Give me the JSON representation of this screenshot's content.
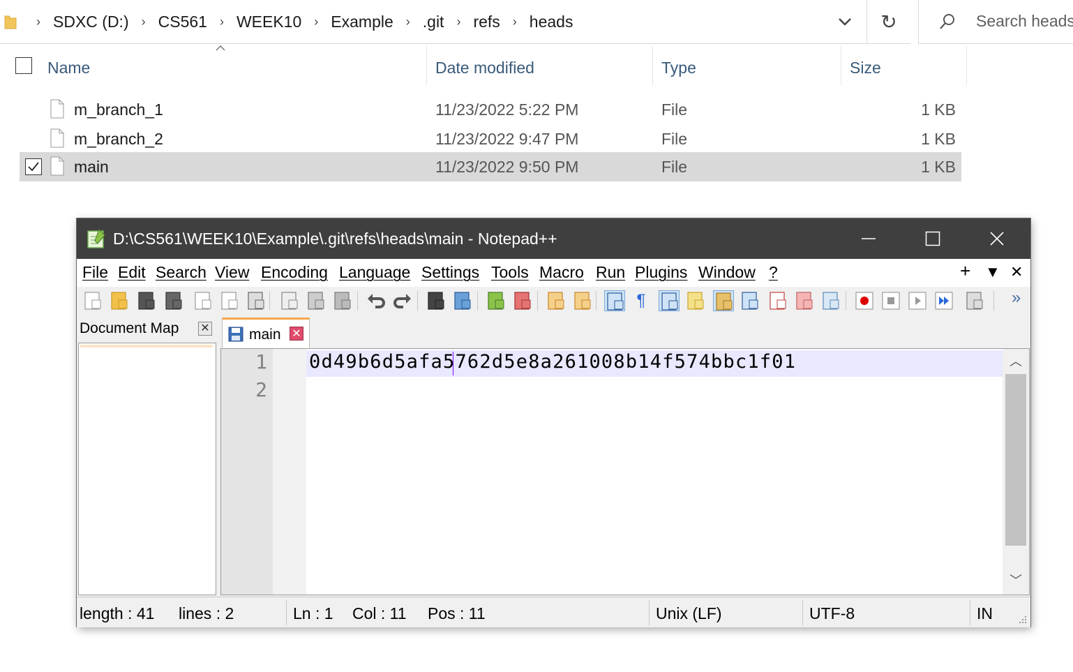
{
  "explorer": {
    "breadcrumb": [
      "SDXC (D:)",
      "CS561",
      "WEEK10",
      "Example",
      ".git",
      "refs",
      "heads"
    ],
    "search_placeholder": "Search heads",
    "columns": {
      "name": "Name",
      "date": "Date modified",
      "type": "Type",
      "size": "Size"
    },
    "files": [
      {
        "name": "m_branch_1",
        "date": "11/23/2022 5:22 PM",
        "type": "File",
        "size": "1 KB",
        "selected": false
      },
      {
        "name": "m_branch_2",
        "date": "11/23/2022 9:47 PM",
        "type": "File",
        "size": "1 KB",
        "selected": false
      },
      {
        "name": "main",
        "date": "11/23/2022 9:50 PM",
        "type": "File",
        "size": "1 KB",
        "selected": true
      }
    ]
  },
  "notepad": {
    "title": "D:\\CS561\\WEEK10\\Example\\.git\\refs\\heads\\main - Notepad++",
    "menu": [
      "File",
      "Edit",
      "Search",
      "View",
      "Encoding",
      "Language",
      "Settings",
      "Tools",
      "Macro",
      "Run",
      "Plugins",
      "Window",
      "?"
    ],
    "menu_right": {
      "plus": "+",
      "down": "▼",
      "close": "✕"
    },
    "toolbar_overflow": "»",
    "docmap_title": "Document Map",
    "tab_label": "main",
    "line_numbers": [
      "1",
      "2"
    ],
    "content_line1": "0d49b6d5afa5762d5e8a261008b14f574bbc1f01",
    "status": {
      "length": "length : 41",
      "lines": "lines : 2",
      "ln": "Ln : 1",
      "col": "Col : 11",
      "pos": "Pos : 11",
      "eol": "Unix (LF)",
      "encoding": "UTF-8",
      "mode": "IN"
    }
  },
  "colors": {
    "titlebar": "#3f3f3f",
    "selection_row": "#d9d9d9",
    "current_line": "#e8e8ff",
    "caret": "#8000ff",
    "tab_accent": "#f7a54a"
  }
}
